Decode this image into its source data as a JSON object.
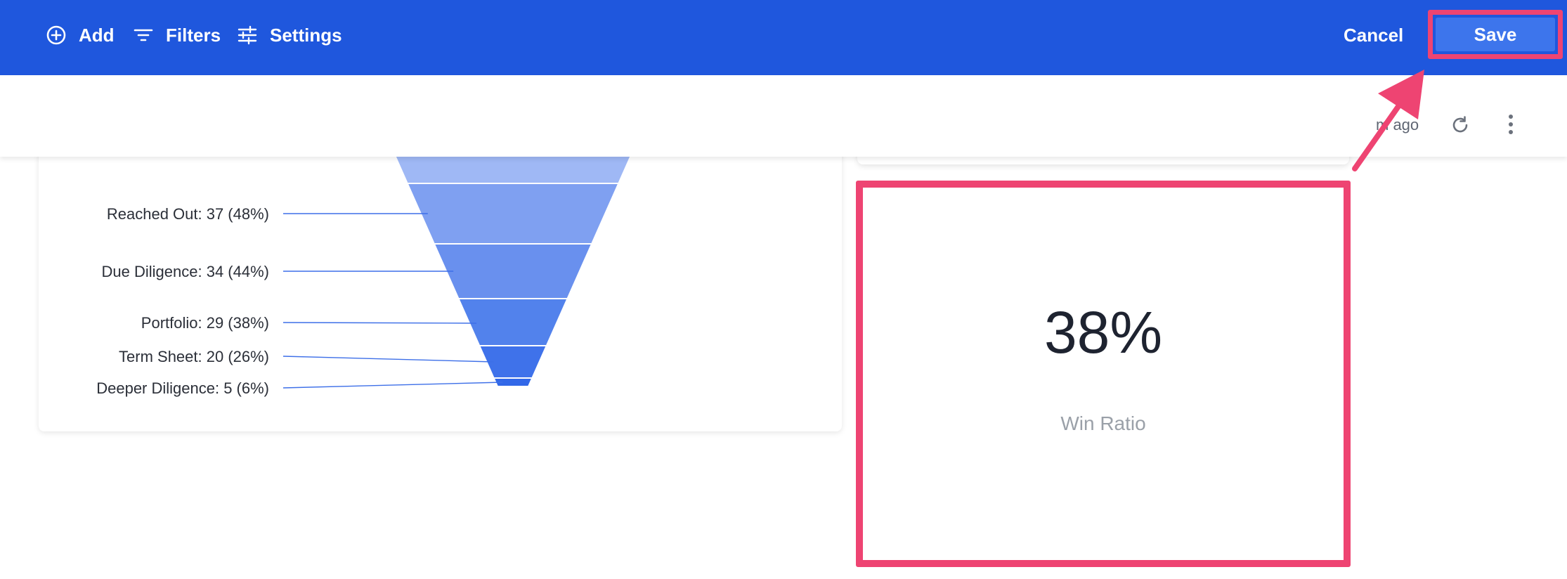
{
  "toolbar": {
    "add_label": "Add",
    "filters_label": "Filters",
    "settings_label": "Settings",
    "cancel_label": "Cancel",
    "save_label": "Save"
  },
  "subheader": {
    "updated_text": "m ago"
  },
  "chart_data": {
    "type": "funnel",
    "stages": [
      {
        "name": "Reached Out",
        "label": "Reached Out: 37 (48%)",
        "value": 37,
        "percent": 48
      },
      {
        "name": "Due Diligence",
        "label": "Due Diligence: 34 (44%)",
        "value": 34,
        "percent": 44
      },
      {
        "name": "Portfolio",
        "label": "Portfolio: 29 (38%)",
        "value": 29,
        "percent": 38
      },
      {
        "name": "Term Sheet",
        "label": "Term Sheet: 20 (26%)",
        "value": 20,
        "percent": 26
      },
      {
        "name": "Deeper Diligence",
        "label": "Deeper Diligence: 5 (6%)",
        "value": 5,
        "percent": 6
      }
    ],
    "colors": [
      "#9fb8f5",
      "#7fa0f1",
      "#6990ee",
      "#5282ec",
      "#3f72ea",
      "#3268e8"
    ]
  },
  "kpi": {
    "value": "38%",
    "label": "Win Ratio"
  },
  "colors": {
    "toolbar_bg": "#1f57dd",
    "save_bg": "#3d75ec",
    "highlight": "#ee4472"
  },
  "icons": {
    "add": "plus-circle-icon",
    "filters": "filter-lines-icon",
    "settings": "sliders-icon",
    "refresh": "refresh-icon",
    "more": "more-vertical-icon"
  }
}
